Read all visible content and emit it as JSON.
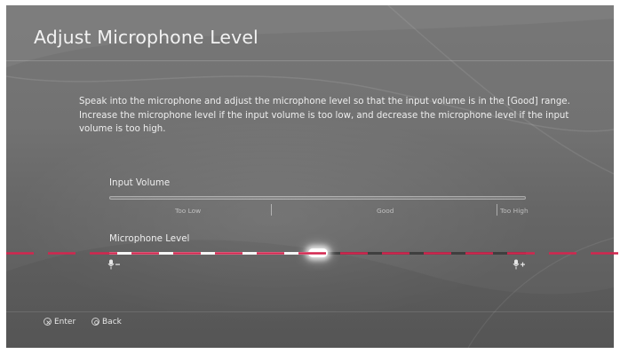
{
  "screen": {
    "title": "Adjust Microphone Level",
    "description": [
      "Speak into the microphone and adjust the microphone level so that the input volume is in the [Good] range.",
      "Increase the microphone level if the input volume is too low, and decrease the microphone level if the input volume is too high."
    ]
  },
  "input_volume": {
    "label": "Input Volume",
    "zones": [
      "Too Low",
      "Good",
      "Too High"
    ],
    "level": 0
  },
  "microphone_level": {
    "label": "Microphone Level",
    "value": 0.5,
    "icons": [
      "mic-minus-icon",
      "mic-plus-icon"
    ]
  },
  "footer": {
    "enter_label": "Enter",
    "enter_icon": "cross-button-icon",
    "back_label": "Back",
    "back_icon": "circle-button-icon"
  },
  "colors": {
    "overlay_dash": "#d2264f",
    "background": "#6f6f6f",
    "text": "#eeeeee"
  }
}
